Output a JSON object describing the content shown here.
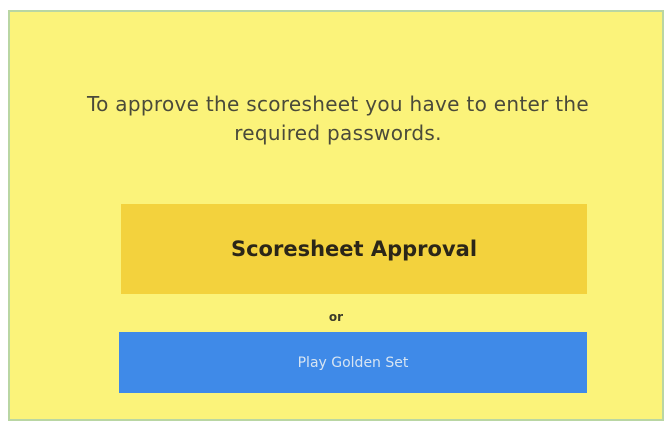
{
  "dialog": {
    "message": "To approve the scoresheet you have to enter the required passwords.",
    "approval_button_label": "Scoresheet Approval",
    "separator_text": "or",
    "golden_set_button_label": "Play Golden Set"
  },
  "colors": {
    "panel_background": "#fbf37a",
    "panel_border": "#b9d6a3",
    "approval_button": "#f3d23d",
    "golden_set_button": "#3f8ae8"
  }
}
